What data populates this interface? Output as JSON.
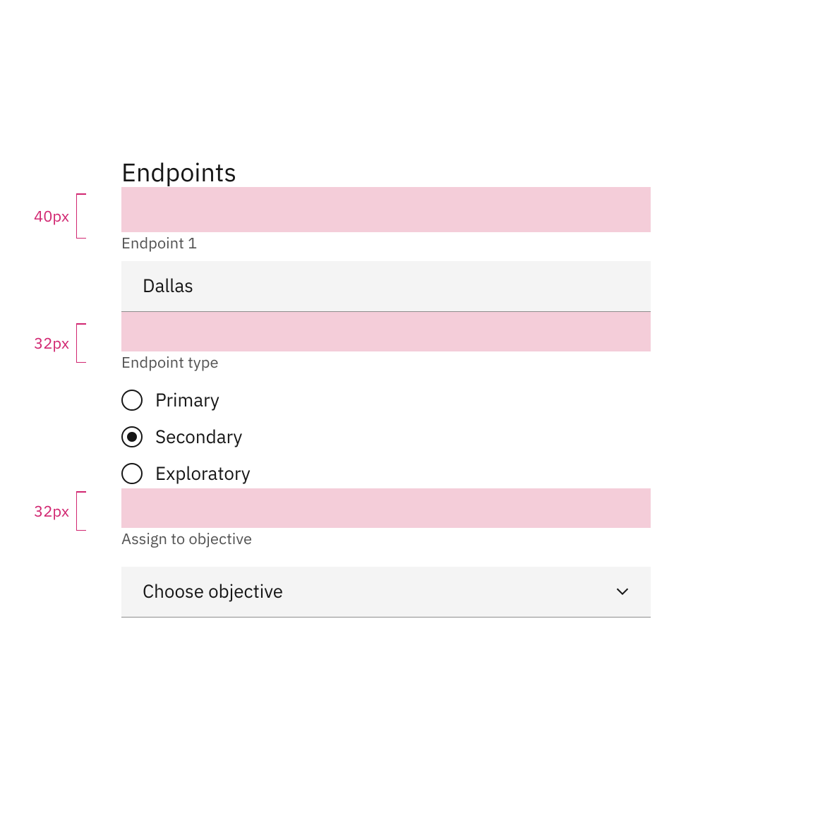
{
  "colors": {
    "spacer_pink": "#f4cdd9",
    "annotation_pink": "#d12771",
    "input_bg": "#f4f4f4",
    "underline": "#8d8d8d",
    "label_gray": "#525252",
    "text": "#161616"
  },
  "section": {
    "title": "Endpoints"
  },
  "annotations": {
    "spacer1": "40px",
    "spacer2": "32px",
    "spacer3": "32px"
  },
  "fields": {
    "endpoint1": {
      "label": "Endpoint 1",
      "value": "Dallas"
    },
    "endpoint_type": {
      "label": "Endpoint type",
      "options": {
        "primary": "Primary",
        "secondary": "Secondary",
        "exploratory": "Exploratory"
      },
      "selected": "secondary"
    },
    "assign_objective": {
      "label": "Assign to objective",
      "placeholder": "Choose objective"
    }
  }
}
